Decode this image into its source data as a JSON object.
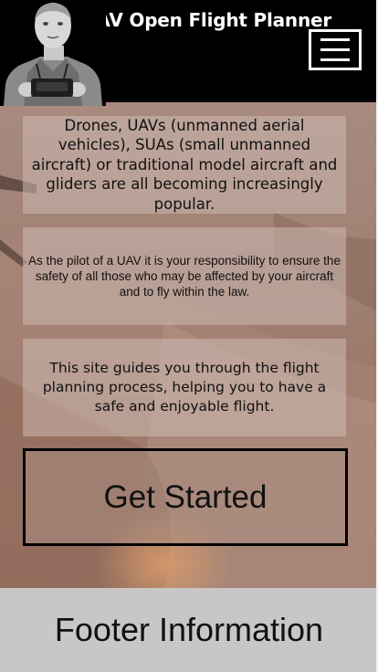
{
  "header": {
    "title": "UAV Open Flight Planner",
    "menu_icon": "hamburger-menu-icon",
    "avatar_icon": "pilot-photo"
  },
  "main": {
    "cards": [
      "Drones, UAVs (unmanned aerial vehicles), SUAs (small unmanned aircraft) or traditional model aircraft and gliders are all becoming increasingly popular.",
      "As the pilot of a UAV it is your responsibility to ensure the safety of all those who may be affected by your aircraft and to fly within the law.",
      "This site guides you through the flight planning process, helping you to have a safe and enjoyable flight."
    ],
    "cta_label": "Get Started"
  },
  "footer": {
    "text": "Footer Information"
  },
  "colors": {
    "header_bg": "#000000",
    "card_bg": "#cdb9b2",
    "footer_bg": "#c8c6c6"
  }
}
